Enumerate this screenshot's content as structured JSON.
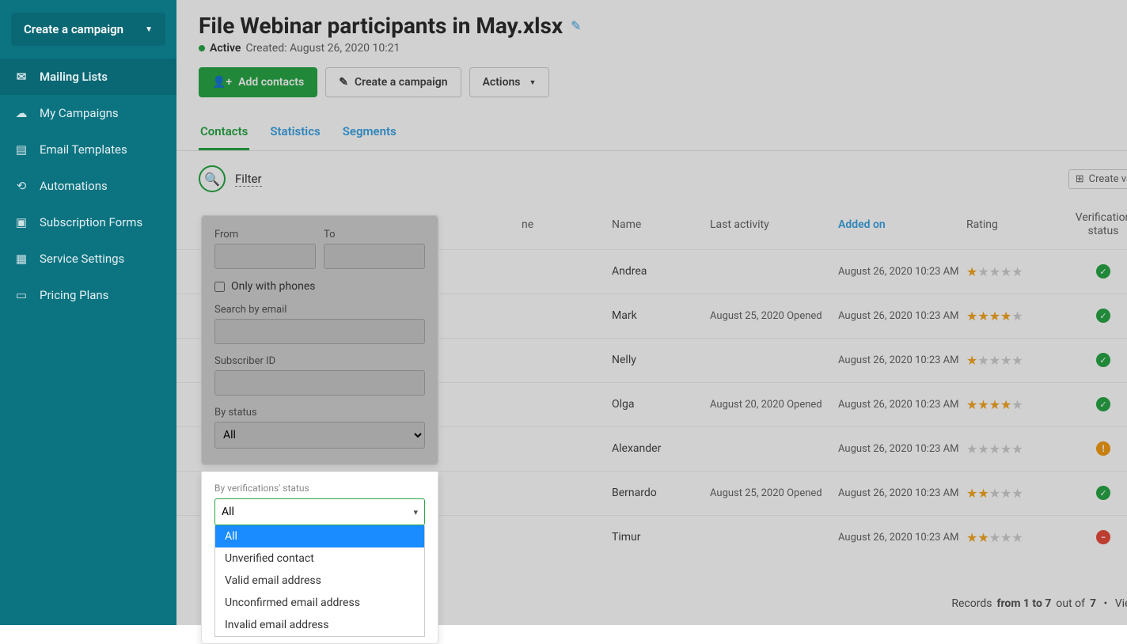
{
  "sidebar": {
    "create_btn": "Create a campaign",
    "items": [
      {
        "icon": "✉",
        "label": "Mailing Lists",
        "active": true
      },
      {
        "icon": "☁",
        "label": "My Campaigns"
      },
      {
        "icon": "▤",
        "label": "Email Templates"
      },
      {
        "icon": "⟲",
        "label": "Automations"
      },
      {
        "icon": "▣",
        "label": "Subscription Forms"
      },
      {
        "icon": "▦",
        "label": "Service Settings"
      },
      {
        "icon": "▭",
        "label": "Pricing Plans"
      }
    ]
  },
  "header": {
    "title": "File Webinar participants in May.xlsx",
    "status": "Active",
    "created": "Created: August 26, 2020 10:21",
    "add_contacts": "Add contacts",
    "create_campaign": "Create a campaign",
    "actions": "Actions"
  },
  "tabs": [
    "Contacts",
    "Statistics",
    "Segments"
  ],
  "filter_bar": {
    "filter": "Filter",
    "create_variable": "Create variable"
  },
  "table": {
    "headers": {
      "phone": "ne",
      "name": "Name",
      "activity": "Last activity",
      "added": "Added on",
      "rating": "Rating",
      "verif": "Verification status"
    },
    "rows": [
      {
        "name": "Andrea",
        "activity": "",
        "added": "August 26, 2020 10:23 AM",
        "rating": 1,
        "verif": "ok"
      },
      {
        "name": "Mark",
        "activity": "August 25, 2020 Opened",
        "added": "August 26, 2020 10:23 AM",
        "rating": 4,
        "verif": "ok"
      },
      {
        "name": "Nelly",
        "activity": "",
        "added": "August 26, 2020 10:23 AM",
        "rating": 1,
        "verif": "ok"
      },
      {
        "name": "Olga",
        "activity": "August 20, 2020 Opened",
        "added": "August 26, 2020 10:23 AM",
        "rating": 4,
        "verif": "ok"
      },
      {
        "name": "Alexander",
        "activity": "",
        "added": "August 26, 2020 10:23 AM",
        "rating": 0,
        "verif": "warn"
      },
      {
        "name": "Bernardo",
        "activity": "August 25, 2020 Opened",
        "added": "August 26, 2020 10:23 AM",
        "rating": 2,
        "verif": "ok"
      },
      {
        "name": "Timur",
        "activity": "",
        "added": "August 26, 2020 10:23 AM",
        "rating": 2,
        "verif": "bad"
      }
    ]
  },
  "filter_pop": {
    "from": "From",
    "to": "To",
    "only_phones": "Only with phones",
    "search_email": "Search by email",
    "sub_id": "Subscriber ID",
    "by_status": "By status",
    "status_sel": "All"
  },
  "verif": {
    "label": "By verifications' status",
    "selected": "All",
    "options": [
      "All",
      "Unverified contact",
      "Valid email address",
      "Unconfirmed email address",
      "Invalid email address"
    ]
  },
  "footer": {
    "prefix": "Records ",
    "bold": "from 1 to 7",
    "mid": " out of ",
    "total": "7",
    "view": "View"
  }
}
